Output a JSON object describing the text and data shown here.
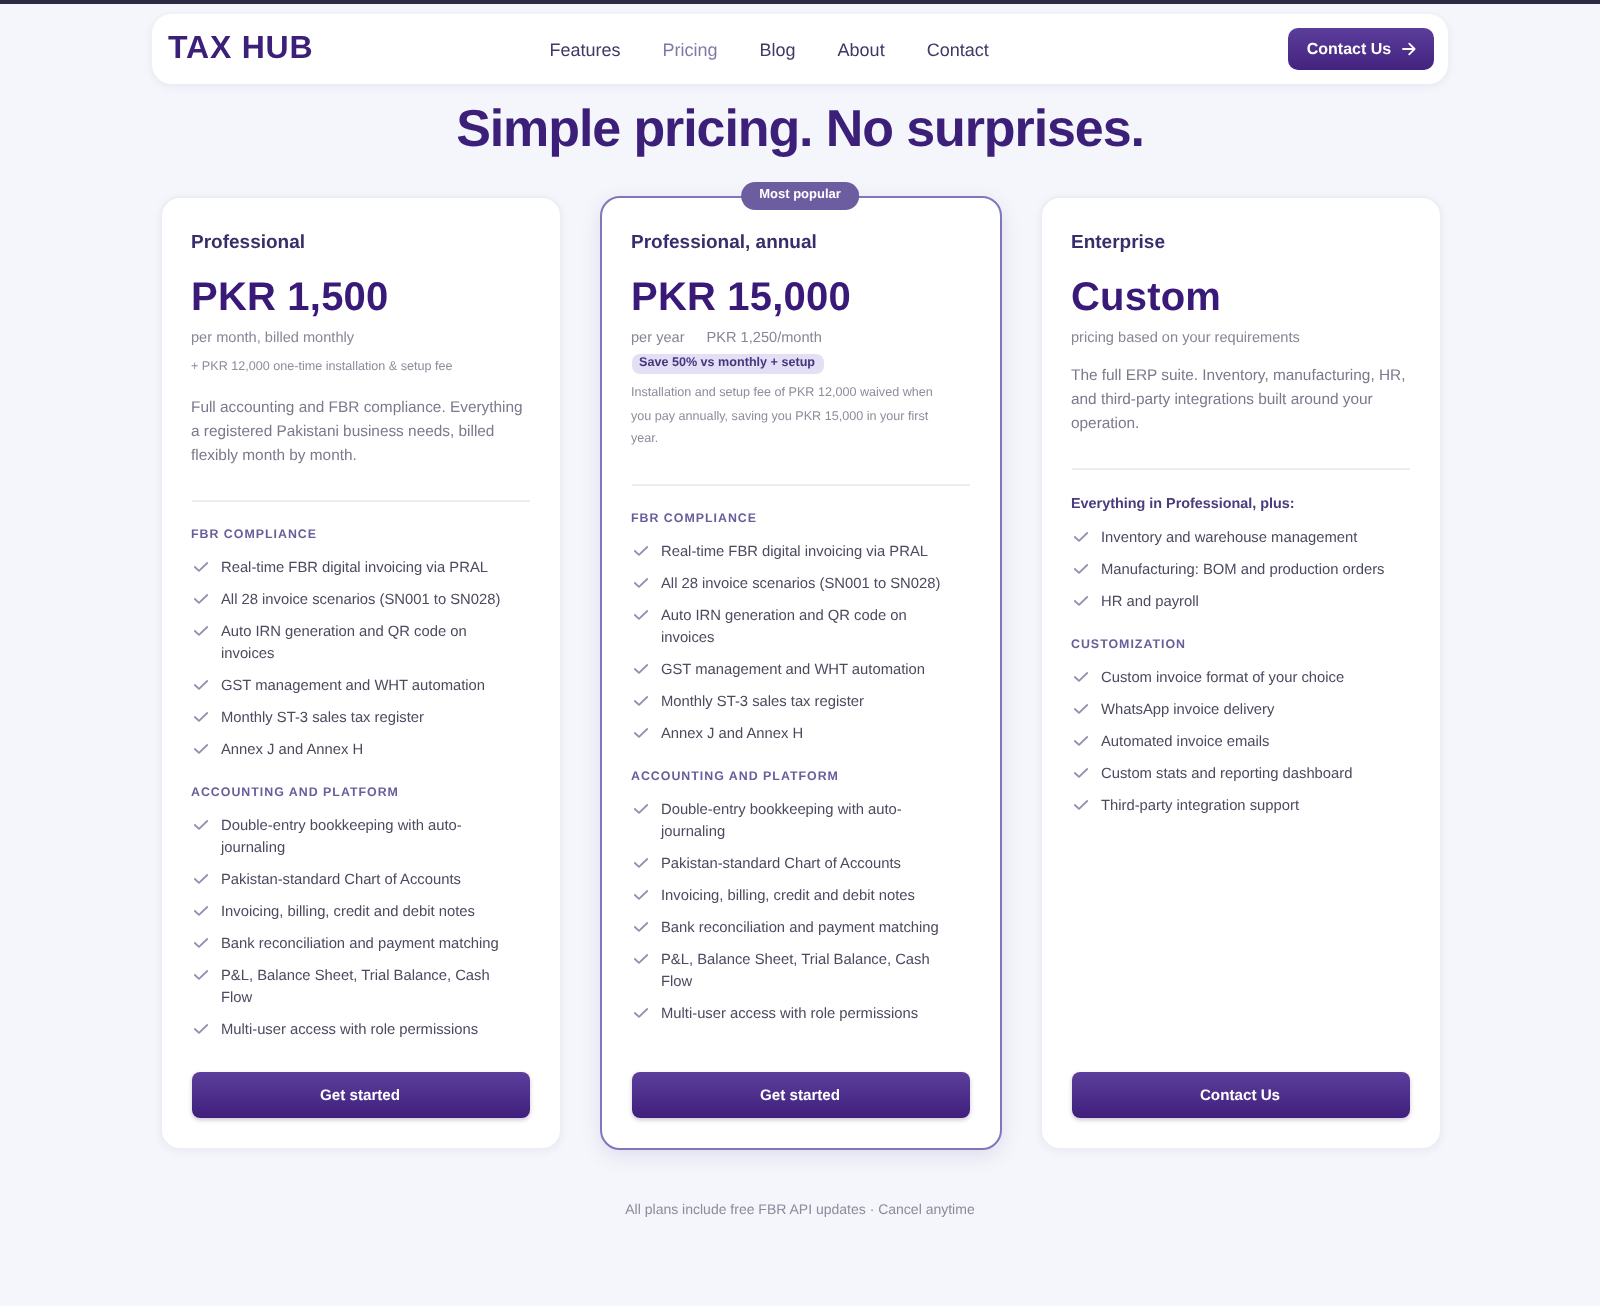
{
  "nav": {
    "logo": "TAX HUB",
    "links": [
      {
        "label": "Features",
        "selected": false
      },
      {
        "label": "Pricing",
        "selected": true
      },
      {
        "label": "Blog",
        "selected": false
      },
      {
        "label": "About",
        "selected": false
      },
      {
        "label": "Contact",
        "selected": false
      }
    ],
    "cta": "Contact Us"
  },
  "heading": "Simple pricing. No surprises.",
  "plans": [
    {
      "name": "Professional",
      "featured": false,
      "price": "PKR 1,500",
      "billing": [
        "per month, billed monthly"
      ],
      "fee_note": "+ PKR 12,000 one-time installation & setup fee",
      "description": "Full accounting and FBR compliance. Everything a registered Pakistani business needs, billed flexibly month by month.",
      "groups": [
        {
          "kind": "section",
          "title": "FBR COMPLIANCE",
          "features": [
            "Real-time FBR digital invoicing via PRAL",
            "All 28 invoice scenarios (SN001 to SN028)",
            "Auto IRN generation and QR code on invoices",
            "GST management and WHT automation",
            "Monthly ST-3 sales tax register",
            "Annex J and Annex H"
          ]
        },
        {
          "kind": "section",
          "title": "ACCOUNTING AND PLATFORM",
          "features": [
            "Double-entry bookkeeping with auto-journaling",
            "Pakistan-standard Chart of Accounts",
            "Invoicing, billing, credit and debit notes",
            "Bank reconciliation and payment matching",
            "P&L, Balance Sheet, Trial Balance, Cash Flow",
            "Multi-user access with role permissions"
          ]
        }
      ],
      "button": "Get started"
    },
    {
      "name": "Professional, annual",
      "featured": true,
      "badge": "Most popular",
      "price": "PKR 15,000",
      "billing": [
        "per year",
        "PKR 1,250/month"
      ],
      "save_tag": "Save 50% vs monthly + setup",
      "fee_note": "Installation and setup fee of PKR 12,000 waived when you pay annually, saving you PKR 15,000 in your first year.",
      "groups": [
        {
          "kind": "section",
          "title": "FBR COMPLIANCE",
          "features": [
            "Real-time FBR digital invoicing via PRAL",
            "All 28 invoice scenarios (SN001 to SN028)",
            "Auto IRN generation and QR code on invoices",
            "GST management and WHT automation",
            "Monthly ST-3 sales tax register",
            "Annex J and Annex H"
          ]
        },
        {
          "kind": "section",
          "title": "ACCOUNTING AND PLATFORM",
          "features": [
            "Double-entry bookkeeping with auto-journaling",
            "Pakistan-standard Chart of Accounts",
            "Invoicing, billing, credit and debit notes",
            "Bank reconciliation and payment matching",
            "P&L, Balance Sheet, Trial Balance, Cash Flow",
            "Multi-user access with role permissions"
          ]
        }
      ],
      "button": "Get started"
    },
    {
      "name": "Enterprise",
      "featured": false,
      "price": "Custom",
      "billing": [
        "pricing based on your requirements"
      ],
      "description": "The full ERP suite. Inventory, manufacturing, HR, and third-party integrations built around your operation.",
      "groups": [
        {
          "kind": "lead",
          "title": "Everything in Professional, plus:",
          "features": [
            "Inventory and warehouse management",
            "Manufacturing: BOM and production orders",
            "HR and payroll"
          ]
        },
        {
          "kind": "section",
          "title": "CUSTOMIZATION",
          "features": [
            "Custom invoice format of your choice",
            "WhatsApp invoice delivery",
            "Automated invoice emails",
            "Custom stats and reporting dashboard",
            "Third-party integration support"
          ]
        }
      ],
      "button": "Contact Us"
    }
  ],
  "footnote": "All plans include free FBR API updates · Cancel anytime"
}
